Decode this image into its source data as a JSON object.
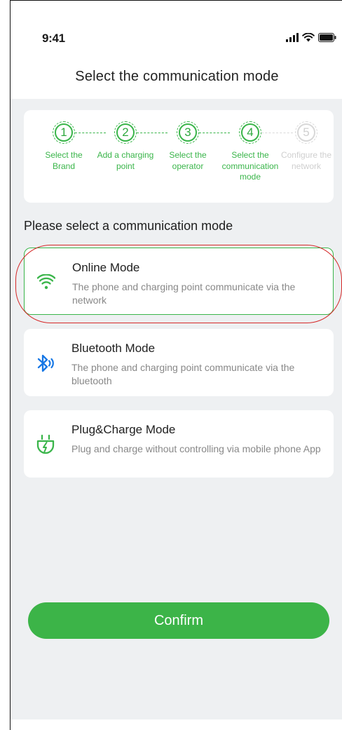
{
  "status_bar": {
    "time": "9:41"
  },
  "header": {
    "title": "Select the communication mode"
  },
  "stepper": {
    "steps": [
      {
        "number": "1",
        "label": "Select the Brand",
        "state": "done"
      },
      {
        "number": "2",
        "label": "Add a charging point",
        "state": "done"
      },
      {
        "number": "3",
        "label": "Select the operator",
        "state": "done"
      },
      {
        "number": "4",
        "label": "Select the communication mode",
        "state": "active"
      },
      {
        "number": "5",
        "label": "Configure the network",
        "state": "disabled"
      }
    ]
  },
  "section_title": "Please select a communication mode",
  "modes": [
    {
      "name": "Online Mode",
      "description": "The phone and charging point communicate via the network",
      "icon": "wifi-icon",
      "selected": true
    },
    {
      "name": "Bluetooth Mode",
      "description": "The phone and charging point communicate via the bluetooth",
      "icon": "bluetooth-icon",
      "selected": false
    },
    {
      "name": "Plug&Charge Mode",
      "description": "Plug and charge without controlling via mobile phone App",
      "icon": "plug-icon",
      "selected": false
    }
  ],
  "confirm_label": "Confirm",
  "colors": {
    "accent": "#3cb448",
    "highlight": "#d62828",
    "background": "#eef0f2"
  }
}
